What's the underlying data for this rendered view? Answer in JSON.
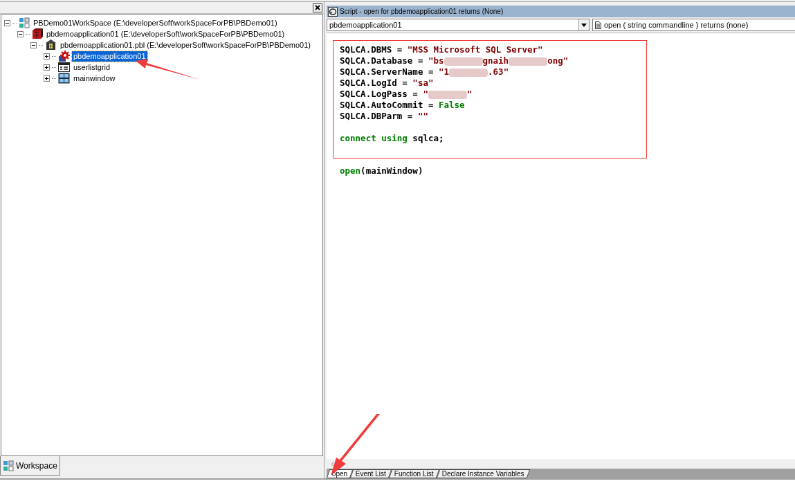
{
  "workspace": {
    "tree": [
      {
        "label": "PBDemo01WorkSpace (E:\\developerSoft\\workSpaceForPB\\PBDemo01)",
        "kind": "workspace",
        "expanded": true,
        "selected": false,
        "children": [
          {
            "label": "pbdemoapplication01 (E:\\developerSoft\\workSpaceForPB\\PBDemo01)",
            "kind": "target",
            "expanded": true,
            "selected": false,
            "children": [
              {
                "label": "pbdemoapplication01.pbl (E:\\developerSoft\\workSpaceForPB\\PBDemo01)",
                "kind": "library",
                "expanded": true,
                "selected": false,
                "children": [
                  {
                    "label": "pbdemoapplication01",
                    "kind": "application",
                    "expanded": false,
                    "selected": true
                  },
                  {
                    "label": "userlistgrid",
                    "kind": "datawindow",
                    "expanded": false,
                    "selected": false
                  },
                  {
                    "label": "mainwindow",
                    "kind": "window",
                    "expanded": false,
                    "selected": false
                  }
                ]
              }
            ]
          }
        ]
      }
    ],
    "tab": {
      "label": "Workspace",
      "selected": true
    }
  },
  "script": {
    "title": "Script - open for pbdemoapplication01 returns (None)",
    "object_select": {
      "value": "pbdemoapplication01"
    },
    "event_select": {
      "value": "open ( string commandline ) returns (none)"
    },
    "boxed_lines": [
      {
        "kind": "code",
        "tokens": [
          {
            "kind": "plain",
            "text": "SQLCA.DBMS = "
          },
          {
            "kind": "string",
            "text": "\"MSS Microsoft SQL Server\""
          }
        ]
      },
      {
        "kind": "code",
        "tokens": [
          {
            "kind": "plain",
            "text": "SQLCA.Database = "
          },
          {
            "kind": "string",
            "text": "\"bs"
          },
          {
            "kind": "redacted"
          },
          {
            "kind": "string",
            "text": "gnaih"
          },
          {
            "kind": "redacted"
          },
          {
            "kind": "string",
            "text": "ong\""
          }
        ]
      },
      {
        "kind": "code",
        "tokens": [
          {
            "kind": "plain",
            "text": "SQLCA.ServerName = "
          },
          {
            "kind": "string",
            "text": "\"1"
          },
          {
            "kind": "redacted"
          },
          {
            "kind": "string",
            "text": ".63\""
          }
        ]
      },
      {
        "kind": "code",
        "tokens": [
          {
            "kind": "plain",
            "text": "SQLCA.LogId = "
          },
          {
            "kind": "string",
            "text": "\"sa\""
          }
        ]
      },
      {
        "kind": "code",
        "tokens": [
          {
            "kind": "plain",
            "text": "SQLCA.LogPass = "
          },
          {
            "kind": "string",
            "text": "\""
          },
          {
            "kind": "redacted"
          },
          {
            "kind": "string",
            "text": "\""
          }
        ]
      },
      {
        "kind": "code",
        "tokens": [
          {
            "kind": "plain",
            "text": "SQLCA.AutoCommit = "
          },
          {
            "kind": "keyword",
            "text": "False"
          }
        ]
      },
      {
        "kind": "code",
        "tokens": [
          {
            "kind": "plain",
            "text": "SQLCA.DBParm = "
          },
          {
            "kind": "string",
            "text": "\"\""
          }
        ]
      },
      {
        "kind": "blank"
      },
      {
        "kind": "code",
        "tokens": [
          {
            "kind": "keyword",
            "text": "connect using"
          },
          {
            "kind": "plain",
            "text": " sqlca;"
          }
        ]
      }
    ],
    "lines": [
      {
        "kind": "code",
        "tokens": [
          {
            "kind": "keyword",
            "text": "open"
          },
          {
            "kind": "plain",
            "text": "(mainWindow)"
          }
        ]
      }
    ],
    "tabs": [
      {
        "label": "open",
        "selected": true
      },
      {
        "label": "Event List",
        "selected": false
      },
      {
        "label": "Function List",
        "selected": false
      },
      {
        "label": "Declare Instance Variables",
        "selected": false
      }
    ]
  }
}
